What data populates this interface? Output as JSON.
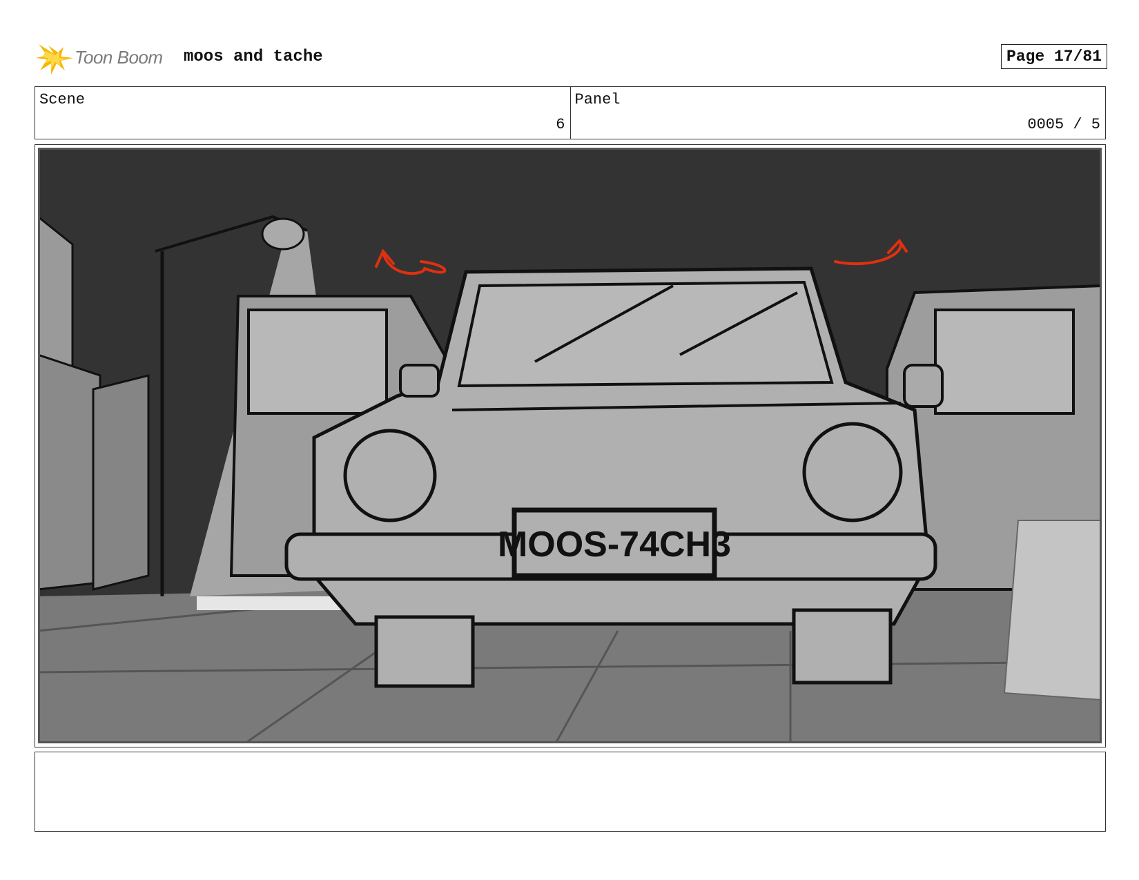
{
  "header": {
    "logo_text": "Toon Boom",
    "project_title": "moos and tache",
    "page_label": "Page 17/81"
  },
  "info": {
    "scene_label": "Scene",
    "scene_value": "6",
    "panel_label": "Panel",
    "panel_value": "0005 / 5"
  },
  "panel": {
    "license_plate": "MOOS-74CH3",
    "colors": {
      "sky": "#333333",
      "car_body": "#b0b0b0",
      "ground": "#7a7a7a",
      "annotation_arrow": "#e03010"
    }
  },
  "notes": {
    "text": ""
  }
}
